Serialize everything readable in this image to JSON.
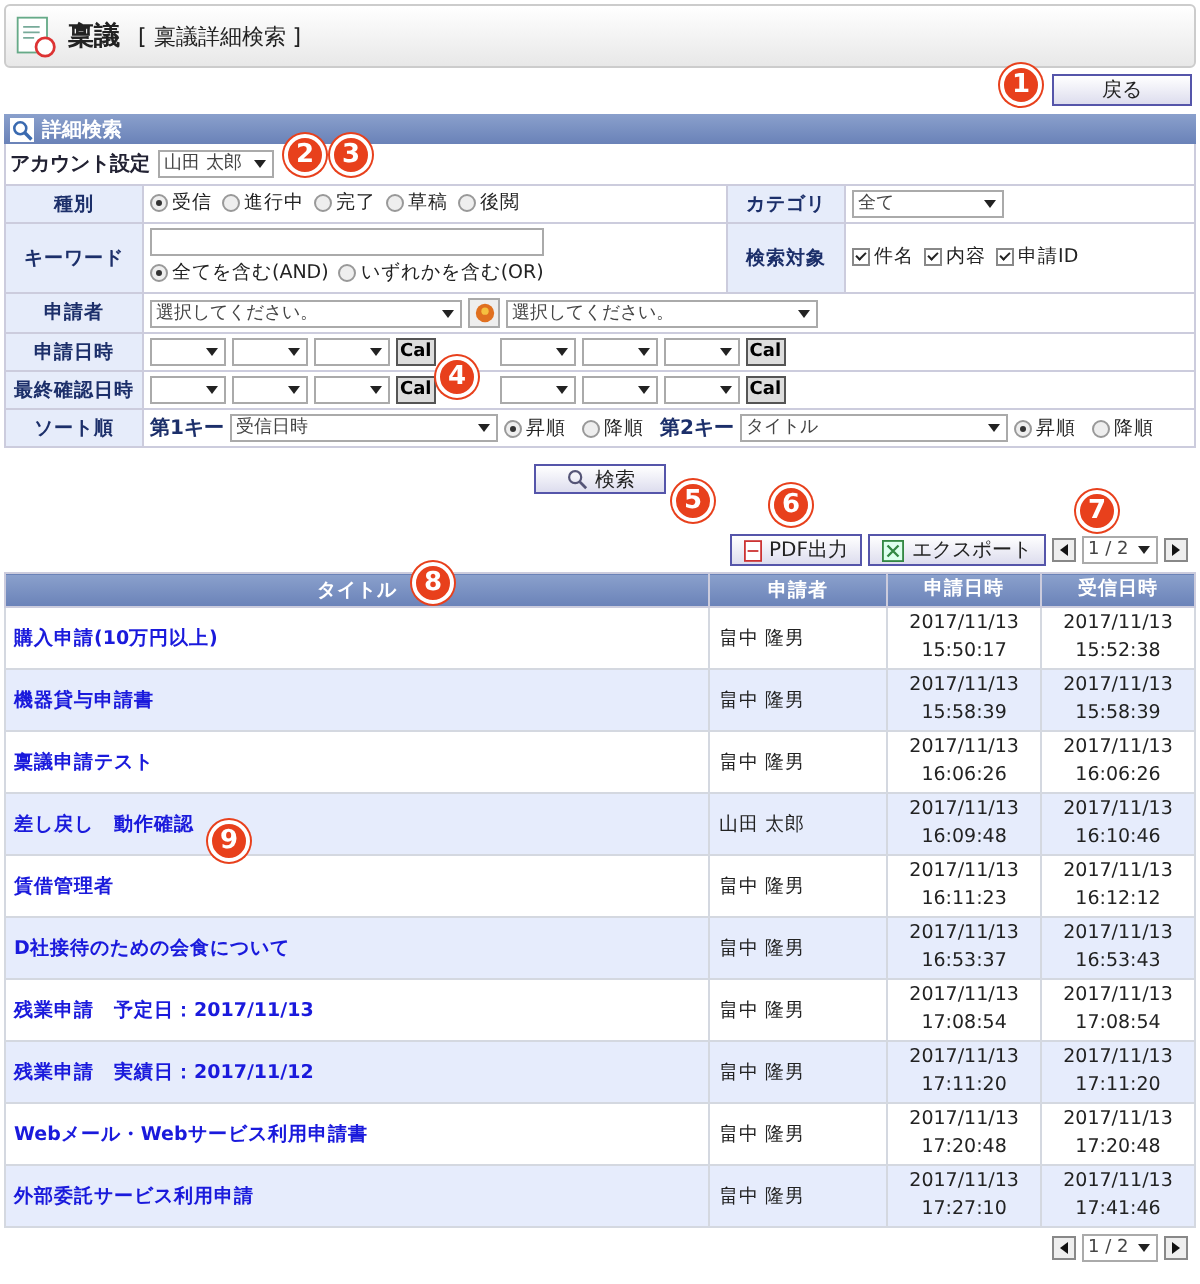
{
  "header": {
    "title": "稟議",
    "subtitle": "[ 稟議詳細検索 ]"
  },
  "back_button": {
    "label": "戻る"
  },
  "search_panel": {
    "title": "詳細検索",
    "account": {
      "label": "アカウント設定",
      "value": "山田 太郎"
    },
    "type": {
      "label": "種別",
      "options": [
        {
          "label": "受信",
          "selected": true
        },
        {
          "label": "進行中",
          "selected": false
        },
        {
          "label": "完了",
          "selected": false
        },
        {
          "label": "草稿",
          "selected": false
        },
        {
          "label": "後閲",
          "selected": false
        }
      ]
    },
    "category": {
      "label": "カテゴリ",
      "value": "全て"
    },
    "keyword": {
      "label": "キーワード",
      "modes": [
        {
          "label": "全てを含む(AND)",
          "selected": true
        },
        {
          "label": "いずれかを含む(OR)",
          "selected": false
        }
      ]
    },
    "target": {
      "label": "検索対象",
      "items": [
        {
          "label": "件名",
          "checked": true
        },
        {
          "label": "内容",
          "checked": true
        },
        {
          "label": "申請ID",
          "checked": true
        }
      ]
    },
    "applicant": {
      "label": "申請者",
      "group_placeholder": "選択してください。",
      "user_placeholder": "選択してください。"
    },
    "date_rows": [
      {
        "label": "申請日時",
        "cals": [
          "Cal",
          "Cal"
        ]
      },
      {
        "label": "最終確認日時",
        "cals": [
          "Cal",
          "Cal"
        ]
      }
    ],
    "sort": {
      "label": "ソート順",
      "keys": [
        {
          "label": "第1キー",
          "value": "受信日時",
          "orders": [
            {
              "label": "昇順",
              "selected": true
            },
            {
              "label": "降順",
              "selected": false
            }
          ]
        },
        {
          "label": "第2キー",
          "value": "タイトル",
          "orders": [
            {
              "label": "昇順",
              "selected": true
            },
            {
              "label": "降順",
              "selected": false
            }
          ]
        }
      ]
    },
    "search_button": "検索"
  },
  "toolbar": {
    "pdf_button": "PDF出力",
    "export_button": "エクスポート",
    "page": "1 / 2"
  },
  "table": {
    "columns": [
      "タイトル",
      "申請者",
      "申請日時",
      "受信日時"
    ],
    "rows": [
      {
        "title": "購入申請(10万円以上)",
        "applicant": "畠中 隆男",
        "applied": [
          "2017/11/13",
          "15:50:17"
        ],
        "received": [
          "2017/11/13",
          "15:52:38"
        ]
      },
      {
        "title": "機器貸与申請書",
        "applicant": "畠中 隆男",
        "applied": [
          "2017/11/13",
          "15:58:39"
        ],
        "received": [
          "2017/11/13",
          "15:58:39"
        ]
      },
      {
        "title": "稟議申請テスト",
        "applicant": "畠中 隆男",
        "applied": [
          "2017/11/13",
          "16:06:26"
        ],
        "received": [
          "2017/11/13",
          "16:06:26"
        ]
      },
      {
        "title": "差し戻し　動作確認",
        "applicant": "山田 太郎",
        "applied": [
          "2017/11/13",
          "16:09:48"
        ],
        "received": [
          "2017/11/13",
          "16:10:46"
        ]
      },
      {
        "title": "賃借管理者",
        "applicant": "畠中 隆男",
        "applied": [
          "2017/11/13",
          "16:11:23"
        ],
        "received": [
          "2017/11/13",
          "16:12:12"
        ]
      },
      {
        "title": "D社接待のための会食について",
        "applicant": "畠中 隆男",
        "applied": [
          "2017/11/13",
          "16:53:37"
        ],
        "received": [
          "2017/11/13",
          "16:53:43"
        ]
      },
      {
        "title": "残業申請　予定日：2017/11/13",
        "applicant": "畠中 隆男",
        "applied": [
          "2017/11/13",
          "17:08:54"
        ],
        "received": [
          "2017/11/13",
          "17:08:54"
        ]
      },
      {
        "title": "残業申請　実績日：2017/11/12",
        "applicant": "畠中 隆男",
        "applied": [
          "2017/11/13",
          "17:11:20"
        ],
        "received": [
          "2017/11/13",
          "17:11:20"
        ]
      },
      {
        "title": "Webメール・Webサービス利用申請書",
        "applicant": "畠中 隆男",
        "applied": [
          "2017/11/13",
          "17:20:48"
        ],
        "received": [
          "2017/11/13",
          "17:20:48"
        ]
      },
      {
        "title": "外部委託サービス利用申請",
        "applicant": "畠中 隆男",
        "applied": [
          "2017/11/13",
          "17:27:10"
        ],
        "received": [
          "2017/11/13",
          "17:41:46"
        ]
      }
    ]
  },
  "bottom_pager": {
    "page": "1 / 2"
  },
  "callouts": [
    "1",
    "2",
    "3",
    "4",
    "5",
    "6",
    "7",
    "8",
    "9"
  ]
}
